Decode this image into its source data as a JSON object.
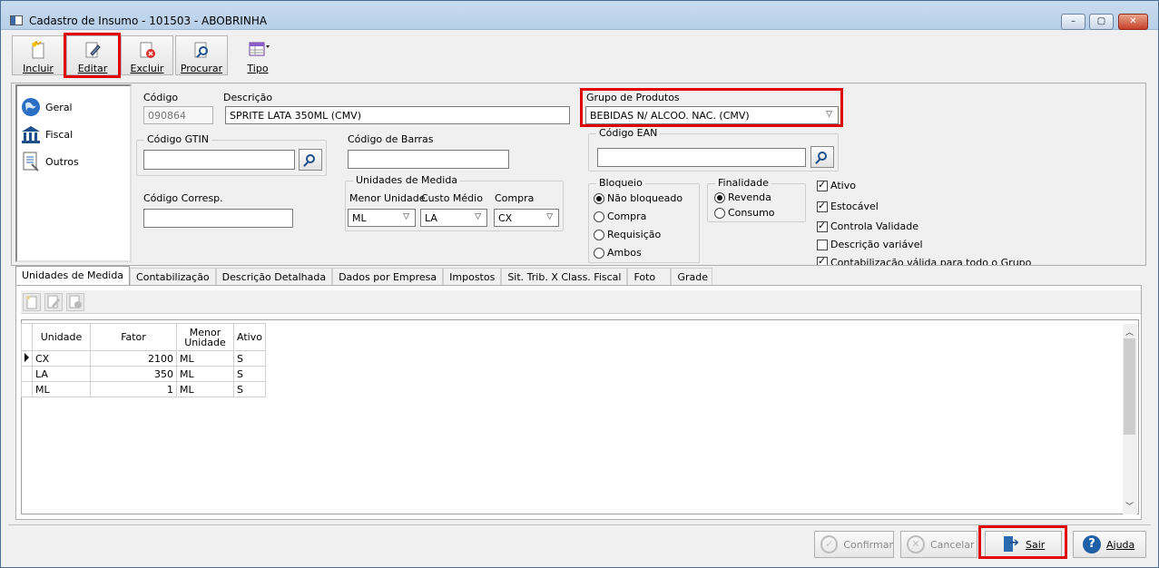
{
  "window": {
    "title": "Cadastro de Insumo - 101503 - ABOBRINHA",
    "min_glyph": "–",
    "max_glyph": "▢",
    "close_glyph": "✕"
  },
  "toolbar": {
    "incluir": "Incluir",
    "editar": "Editar",
    "excluir": "Excluir",
    "procurar": "Procurar",
    "tipo": "Tipo"
  },
  "sidenav": {
    "items": [
      {
        "label": "Geral",
        "icon": "globe-icon"
      },
      {
        "label": "Fiscal",
        "icon": "bank-icon"
      },
      {
        "label": "Outros",
        "icon": "document-list-icon"
      }
    ]
  },
  "form": {
    "codigo_label": "Código",
    "codigo_value": "090864",
    "descricao_label": "Descrição",
    "descricao_value": "SPRITE LATA 350ML (CMV)",
    "grupo_label": "Grupo de Produtos",
    "grupo_value": "BEBIDAS N/ ALCOO. NAC. (CMV)",
    "gtin_label": "Código GTIN",
    "gtin_value": "",
    "barras_label": "Código de Barras",
    "barras_value": "",
    "ean_label": "Código EAN",
    "ean_value": "",
    "corresp_label": "Código Corresp.",
    "corresp_value": "",
    "unidades": {
      "title": "Unidades de Medida",
      "menor_label": "Menor Unidade",
      "menor_value": "ML",
      "custo_label": "Custo Médio",
      "custo_value": "LA",
      "compra_label": "Compra",
      "compra_value": "CX"
    },
    "bloqueio": {
      "title": "Bloqueio",
      "options": [
        "Não bloqueado",
        "Compra",
        "Requisição",
        "Ambos"
      ],
      "selected": "Não bloqueado"
    },
    "finalidade": {
      "title": "Finalidade",
      "options": [
        "Revenda",
        "Consumo"
      ],
      "selected": "Revenda"
    },
    "checks": [
      {
        "label": "Ativo",
        "checked": true
      },
      {
        "label": "Estocável",
        "checked": true
      },
      {
        "label": "Controla Validade",
        "checked": true
      },
      {
        "label": "Descrição variável",
        "checked": false
      },
      {
        "label": "Contabilização válida para todo o Grupo",
        "checked": true
      }
    ]
  },
  "tabs": [
    "Unidades de Medida",
    "Contabilização",
    "Descrição Detalhada",
    "Dados por Empresa",
    "Impostos",
    "Sit. Trib. X Class. Fiscal",
    "Foto",
    "Grade"
  ],
  "grid": {
    "headers": {
      "unidade": "Unidade",
      "fator": "Fator",
      "menor_line1": "Menor",
      "menor_line2": "Unidade",
      "ativo": "Ativo"
    },
    "rows": [
      {
        "unidade": "CX",
        "fator": "2100",
        "menor": "ML",
        "ativo": "S"
      },
      {
        "unidade": "LA",
        "fator": "350",
        "menor": "ML",
        "ativo": "S"
      },
      {
        "unidade": "ML",
        "fator": "1",
        "menor": "ML",
        "ativo": "S"
      }
    ]
  },
  "footer": {
    "confirmar": "Confirmar",
    "cancelar": "Cancelar",
    "sair": "Sair",
    "ajuda": "Ajuda",
    "confirm_glyph": "✓",
    "cancel_glyph": "✕",
    "help_glyph": "?"
  },
  "colors": {
    "highlight": "#e00000",
    "help_blue": "#1f5fa8"
  }
}
